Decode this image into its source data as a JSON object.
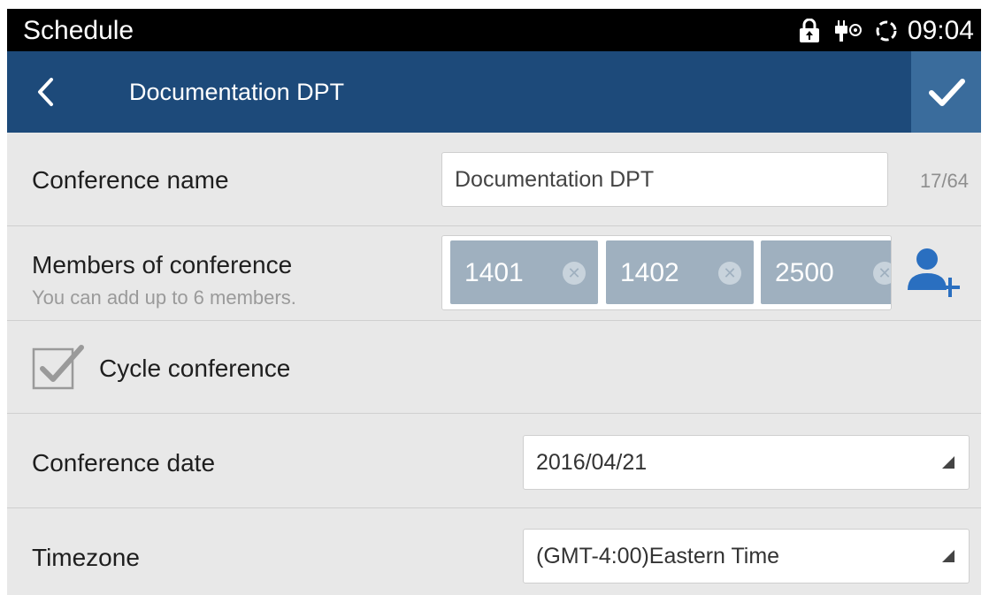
{
  "status_bar": {
    "title": "Schedule",
    "time": "09:04",
    "icons": [
      "lock-icon",
      "usb-debug-icon",
      "sync-icon"
    ]
  },
  "app_bar": {
    "title": "Documentation DPT",
    "back_icon": "chevron-left-icon",
    "confirm_icon": "checkmark-icon"
  },
  "form": {
    "conference_name": {
      "label": "Conference name",
      "value": "Documentation DPT",
      "counter": "17/64"
    },
    "members": {
      "label": "Members of conference",
      "hint": "You can add up to 6 members.",
      "items": [
        "1401",
        "1402",
        "2500"
      ],
      "add_icon": "add-user-icon"
    },
    "cycle": {
      "label": "Cycle conference",
      "checked": true
    },
    "date": {
      "label": "Conference date",
      "value": "2016/04/21"
    },
    "timezone": {
      "label": "Timezone",
      "value": "(GMT-4:00)Eastern Time"
    }
  },
  "colors": {
    "app_bar": "#1d4a7a",
    "confirm_bg": "#3a6c9c",
    "chip": "#9fb0bf",
    "add_icon": "#2a6fc0"
  }
}
